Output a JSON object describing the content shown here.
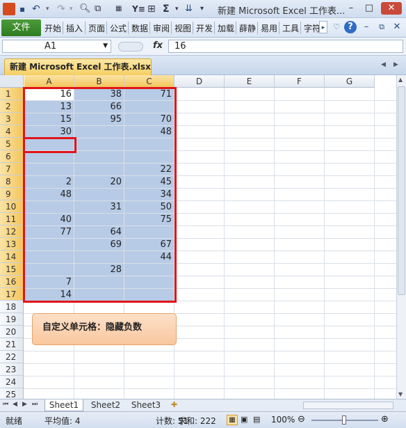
{
  "window": {
    "title": "新建 Microsoft Excel 工作表...",
    "qa_icons": [
      "save-icon",
      "undo-icon",
      "redo-icon",
      "print-preview-icon",
      "format-painter-icon",
      "number-format-icon",
      "filter-icon",
      "borders-icon",
      "autosum-icon",
      "fill-icon",
      "customize-qa-icon"
    ],
    "qa_labels": {
      "autosum": "Σ",
      "filter": "Y≡"
    }
  },
  "ribbon": {
    "file_label": "文件",
    "tabs": [
      "开始",
      "插入",
      "页面",
      "公式",
      "数据",
      "审阅",
      "视图",
      "开发",
      "加载",
      "薛静",
      "易用",
      "工具",
      "字符"
    ]
  },
  "formula_bar": {
    "name_box": "A1",
    "fx_label": "fx",
    "value": "16"
  },
  "workbook": {
    "tab_title": "新建 Microsoft Excel 工作表.xlsx"
  },
  "grid": {
    "columns": [
      "A",
      "B",
      "C",
      "D",
      "E",
      "F",
      "G"
    ],
    "rows": [
      "1",
      "2",
      "3",
      "4",
      "5",
      "6",
      "7",
      "8",
      "9",
      "10",
      "11",
      "12",
      "13",
      "14",
      "15",
      "16",
      "17",
      "18",
      "19",
      "20",
      "21",
      "22",
      "23",
      "24",
      "25"
    ],
    "data": [
      [
        "16",
        "38",
        "71"
      ],
      [
        "13",
        "66",
        ""
      ],
      [
        "15",
        "95",
        "70"
      ],
      [
        "30",
        "",
        "48"
      ],
      [
        "",
        "",
        ""
      ],
      [
        "",
        "",
        ""
      ],
      [
        "",
        "",
        "22"
      ],
      [
        "2",
        "20",
        "45"
      ],
      [
        "48",
        "",
        "34"
      ],
      [
        "",
        "31",
        "50"
      ],
      [
        "40",
        "",
        "75"
      ],
      [
        "77",
        "64",
        ""
      ],
      [
        "",
        "69",
        "67"
      ],
      [
        "",
        "",
        "44"
      ],
      [
        "",
        "28",
        ""
      ],
      [
        "7",
        "",
        ""
      ],
      [
        "14",
        "",
        ""
      ]
    ]
  },
  "annotation": {
    "callout_text": "自定义单元格：隐藏负数"
  },
  "sheets": {
    "tabs": [
      "Sheet1",
      "Sheet2",
      "Sheet3"
    ],
    "active": "Sheet1"
  },
  "status": {
    "ready": "就绪",
    "average": "平均值: 4",
    "count": "计数: 51",
    "sum": "求和: 222",
    "zoom": "100%"
  },
  "colors": {
    "selection": "#b7cbe6",
    "highlight_border": "#e0141a",
    "file_tab": "#3a8a2c",
    "header_selected": "#f3c65d"
  }
}
